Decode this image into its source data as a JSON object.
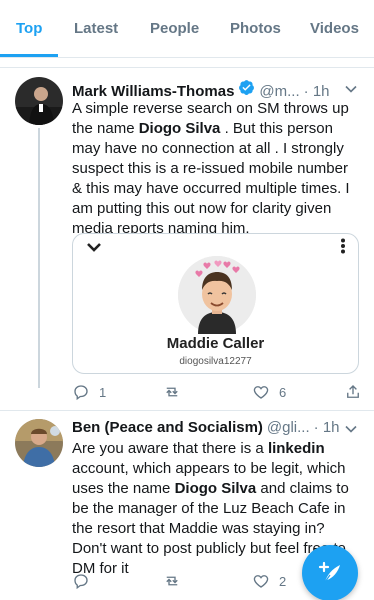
{
  "tabs": [
    {
      "label": "Top",
      "active": true
    },
    {
      "label": "Latest",
      "active": false
    },
    {
      "label": "People",
      "active": false
    },
    {
      "label": "Photos",
      "active": false
    },
    {
      "label": "Videos",
      "active": false
    }
  ],
  "tweets": [
    {
      "name": "Mark Williams-Thomas",
      "verified": true,
      "handle": "@m...",
      "time": "· 1h",
      "text_parts": [
        {
          "t": "A simple reverse search on SM throws up the name ",
          "b": false
        },
        {
          "t": "Diogo Silva",
          "b": true
        },
        {
          "t": " . But this person may have no connection at all . I strongly suspect this is a re-issued mobile number & this may have occurred multiple times. I am putting this out now for clarity given media reports naming him.",
          "b": false
        }
      ],
      "card": {
        "title": "Maddie Caller",
        "subtitle": "diogosilva12277"
      },
      "replies": "1",
      "retweets": "",
      "likes": "6"
    },
    {
      "name": "Ben (Peace and Socialism)",
      "verified": false,
      "handle": "@gli...",
      "time": "· 1h",
      "text_parts": [
        {
          "t": "Are you aware that there is a ",
          "b": false
        },
        {
          "t": "linkedin",
          "b": true
        },
        {
          "t": " account, which appears to be legit, which uses the name ",
          "b": false
        },
        {
          "t": "Diogo Silva",
          "b": true
        },
        {
          "t": " and claims to be the manager of the Luz Beach Cafe in the resort that Maddie was staying in? Don't want to post publicly but feel free to DM for it",
          "b": false
        }
      ],
      "replies": "",
      "retweets": "",
      "likes": "2"
    }
  ],
  "colors": {
    "accent": "#1da1f2",
    "muted": "#657786",
    "divider": "#e1e8ed"
  },
  "icons": {
    "reply": "reply-icon",
    "retweet": "retweet-icon",
    "like": "heart-icon",
    "share": "share-icon",
    "compose": "compose-tweet-icon"
  }
}
